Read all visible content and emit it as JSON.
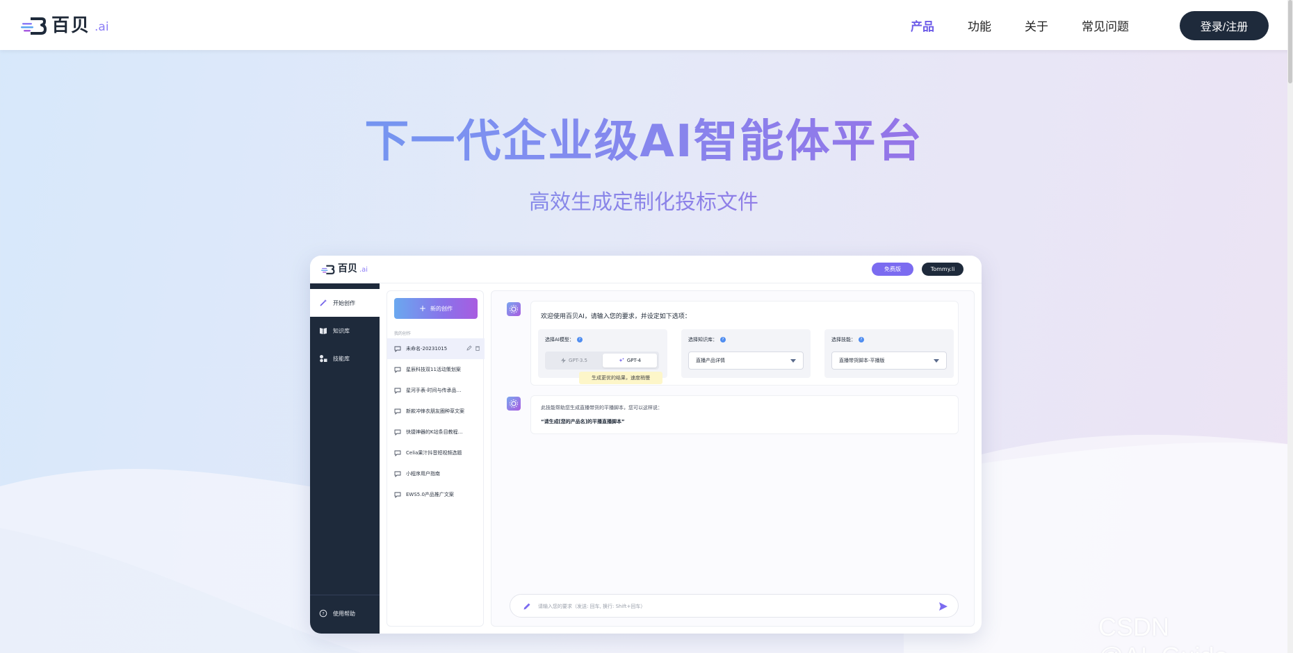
{
  "brand": {
    "name": "百贝",
    "suffix": ".ai"
  },
  "nav": {
    "items": [
      {
        "label": "产品",
        "active": true
      },
      {
        "label": "功能",
        "active": false
      },
      {
        "label": "关于",
        "active": false
      },
      {
        "label": "常见问题",
        "active": false
      }
    ],
    "login_label": "登录/注册"
  },
  "hero": {
    "title": "下一代企业级AI智能体平台",
    "subtitle": "高效生成定制化投标文件"
  },
  "mock": {
    "brand": {
      "name": "百贝",
      "suffix": ".ai"
    },
    "header": {
      "free_label": "免费版",
      "user_label": "Tommy.li"
    },
    "sidebar": {
      "items": [
        {
          "label": "开始创作",
          "icon": "magic-wand-icon",
          "active": true
        },
        {
          "label": "知识库",
          "icon": "book-icon",
          "active": false
        },
        {
          "label": "技能库",
          "icon": "shapes-icon",
          "active": false
        }
      ],
      "help_label": "使用帮助"
    },
    "list": {
      "new_label": "新的创作",
      "section_label": "我的创作",
      "items": [
        {
          "label": "未命名-20231015",
          "active": true
        },
        {
          "label": "星辰科技双11活动策划案",
          "active": false
        },
        {
          "label": "星河手表-时间与传承品…",
          "active": false
        },
        {
          "label": "新款冲锋衣朋友圈种草文案",
          "active": false
        },
        {
          "label": "快捷神器的K站条目教程…",
          "active": false
        },
        {
          "label": "Celia果汁抖音短视频选题",
          "active": false
        },
        {
          "label": "小程序用户指南",
          "active": false
        },
        {
          "label": "EWS5.0产品推广文案",
          "active": false
        }
      ]
    },
    "main": {
      "welcome": "欢迎使用百贝AI，请输入您的要求，并设定如下选项：",
      "model": {
        "label": "选择AI模型：",
        "option_a": "GPT-3.5",
        "option_b": "GPT-4",
        "selected": "GPT-4"
      },
      "knowledge": {
        "label": "选择知识库：",
        "value": "直播产品详情"
      },
      "skill": {
        "label": "选择技能：",
        "value": "直播带货脚本-平播版"
      },
      "tooltip": "生成更优的结果，速度稍慢",
      "skill_msg": "此技能帮助您生成直播带货的平播脚本，您可以这样说：",
      "skill_example": "“请生成[您的产品名]的平播直播脚本”",
      "input_placeholder": "请输入您的要求（发送: 回车, 换行: Shift+回车）"
    }
  },
  "watermark": "CSDN @AI_Guide",
  "colors": {
    "accent": "#6d5ce8",
    "dark": "#1e2a3b",
    "gradient_start": "#5aa3ef",
    "gradient_end": "#a85ce0"
  }
}
